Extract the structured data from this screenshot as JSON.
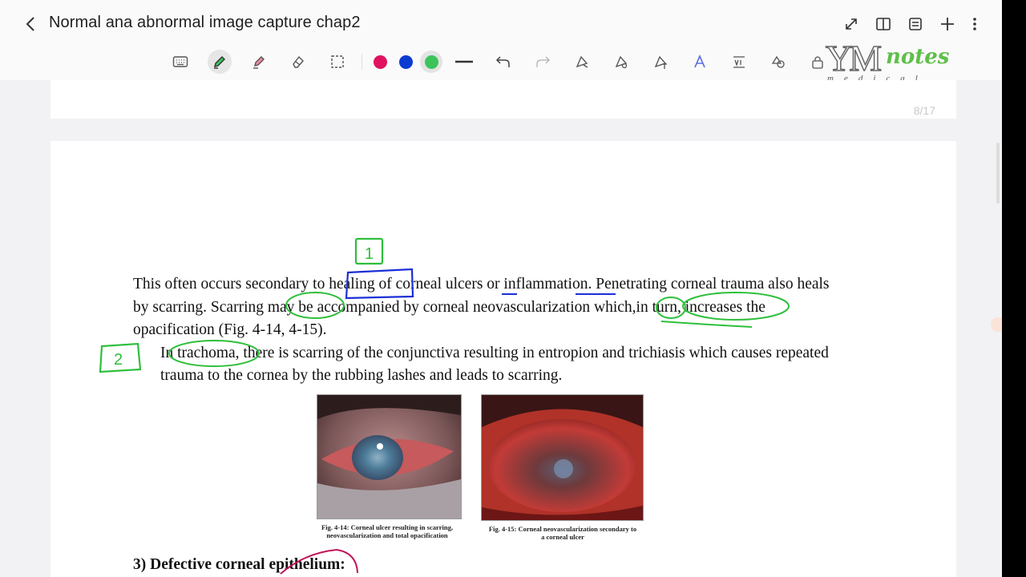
{
  "header": {
    "title": "Normal ana abnormal image capture chap2",
    "icons": [
      "back-icon",
      "expand-icon",
      "book-icon",
      "outline-icon",
      "add-icon",
      "more-icon"
    ]
  },
  "toolbar": {
    "tools": [
      "keyboard-icon",
      "pen-icon",
      "highlighter-icon",
      "eraser-icon",
      "lasso-icon"
    ],
    "active_tool": "pen-icon",
    "colors": [
      "#e0115f",
      "#0b3bd1",
      "#3cc45a"
    ],
    "active_color": "#3cc45a",
    "tools2": [
      "line-style-icon",
      "undo-icon",
      "redo-icon",
      "shape-magic-icon",
      "shape-star-icon",
      "text-tool-icon",
      "ai-assist-icon",
      "text-convert-icon",
      "shapes-icon",
      "lock-icon"
    ]
  },
  "watermark": {
    "ym": "YM",
    "notes": "notes",
    "medical": "medical"
  },
  "document": {
    "page_indicator": "8/17",
    "para1": "This often occurs secondary to healing of corneal ulcers or inflammation. Penetrating corneal trauma also heals by scarring. Scarring may be accompanied by corneal neovascularization which,in turn, increases the opacification (Fig. 4-14, 4-15).",
    "para2": "In trachoma, there is scarring of the conjunctiva resulting in entropion and trichiasis which causes repeated trauma to the cornea by the rubbing lashes and leads to scarring.",
    "fig1_caption_line1": "Fig. 4-14: Corneal ulcer resulting in scarring,",
    "fig1_caption_line2": "neovascularization and total opacification",
    "fig2_caption_line1": "Fig. 4-15: Corneal neovascularization secondary to",
    "fig2_caption_line2": "a corneal ulcer",
    "section_heading": "3) Defective corneal epithelium:"
  },
  "annotations": {
    "box1_label": "1",
    "box2_label": "2",
    "colors": {
      "green": "#2fbf3c",
      "blue": "#1a2fd6",
      "magenta": "#c0145a"
    }
  }
}
